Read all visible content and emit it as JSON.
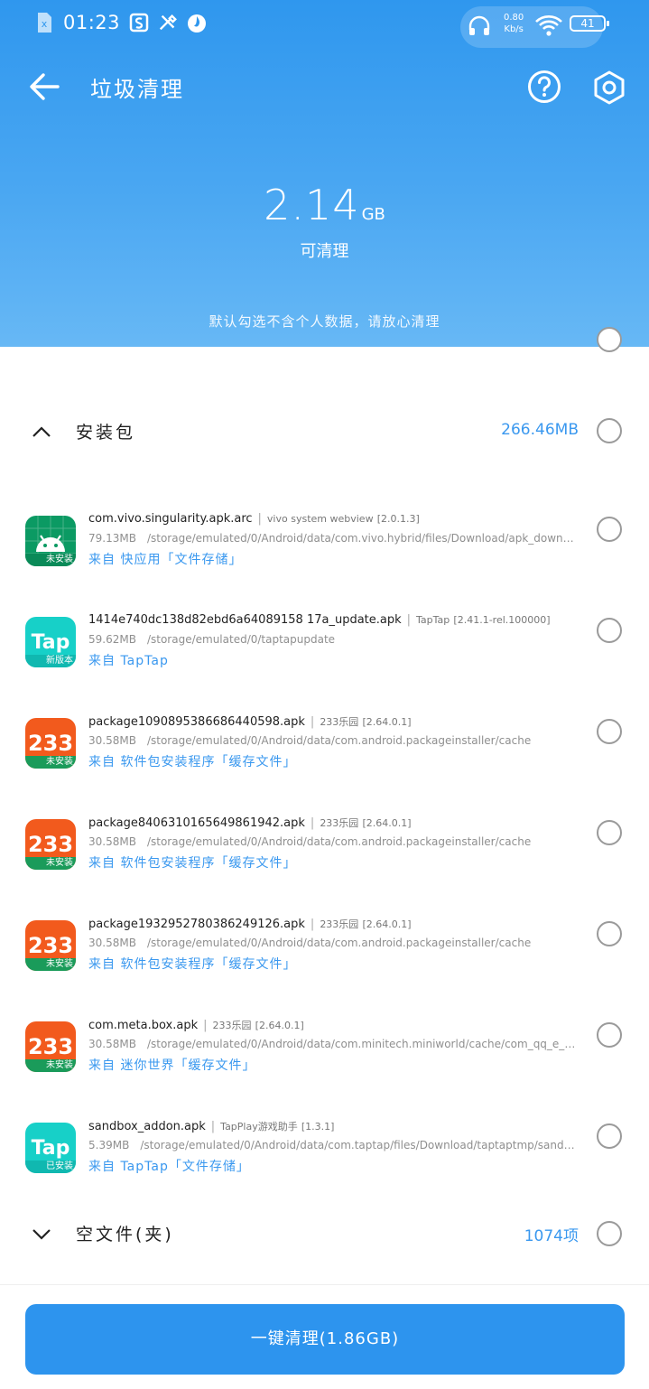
{
  "status_bar": {
    "time": "01:23",
    "net_speed_value": "0.80",
    "net_speed_unit": "Kb/s",
    "battery": "41"
  },
  "app_bar": {
    "title": "垃圾清理"
  },
  "summary": {
    "size_value": "2.14",
    "size_unit": "GB",
    "cleanable_label": "可清理",
    "tip": "默认勾选不含个人数据，请放心清理"
  },
  "sections": {
    "apk": {
      "title": "安装包",
      "size": "266.46MB"
    },
    "empty": {
      "title": "空文件(夹)",
      "count": "1074项"
    }
  },
  "items": [
    {
      "icon": "android-icon",
      "badge": "未安装",
      "name": "com.vivo.singularity.apk.arc",
      "app": "vivo system webview",
      "version": "[2.0.1.3]",
      "size": "79.13MB",
      "path": "/storage/emulated/0/Android/data/com.vivo.hybrid/files/Download/apk_download",
      "source": "来自 快应用「文件存储」"
    },
    {
      "icon": "taptap-icon",
      "badge": "新版本",
      "name": "1414e740dc138d82ebd6a64089158 17a_update.apk",
      "app": "TapTap",
      "version": "[2.41.1-rel.100000]",
      "size": "59.62MB",
      "path": "/storage/emulated/0/taptapupdate",
      "source": "来自 TapTap"
    },
    {
      "icon": "233-icon",
      "badge": "未安装",
      "name": "package1090895386686440598.apk",
      "app": "233乐园",
      "version": "[2.64.0.1]",
      "size": "30.58MB",
      "path": "/storage/emulated/0/Android/data/com.android.packageinstaller/cache",
      "source": "来自 软件包安装程序「缓存文件」"
    },
    {
      "icon": "233-icon",
      "badge": "未安装",
      "name": "package8406310165649861942.apk",
      "app": "233乐园",
      "version": "[2.64.0.1]",
      "size": "30.58MB",
      "path": "/storage/emulated/0/Android/data/com.android.packageinstaller/cache",
      "source": "来自 软件包安装程序「缓存文件」"
    },
    {
      "icon": "233-icon",
      "badge": "未安装",
      "name": "package1932952780386249126.apk",
      "app": "233乐园",
      "version": "[2.64.0.1]",
      "size": "30.58MB",
      "path": "/storage/emulated/0/Android/data/com.android.packageinstaller/cache",
      "source": "来自 软件包安装程序「缓存文件」"
    },
    {
      "icon": "233-icon",
      "badge": "未安装",
      "name": "com.meta.box.apk",
      "app": "233乐园",
      "version": "[2.64.0.1]",
      "size": "30.58MB",
      "path": "/storage/emulated/0/Android/data/com.minitech.miniworld/cache/com_qq_e_dow…",
      "source": "来自 迷你世界「缓存文件」"
    },
    {
      "icon": "taptap-icon",
      "badge": "已安装",
      "name": "sandbox_addon.apk",
      "app": "TapPlay游戏助手",
      "version": "[1.3.1]",
      "size": "5.39MB",
      "path": "/storage/emulated/0/Android/data/com.taptap/files/Download/taptaptmp/sandbo…",
      "source": "来自 TapTap「文件存储」"
    }
  ],
  "cta": {
    "label": "一键清理(1.86GB)"
  },
  "colors": {
    "accent": "#2d94ee",
    "header_top": "#2f97ee",
    "link": "#3a98ef"
  }
}
